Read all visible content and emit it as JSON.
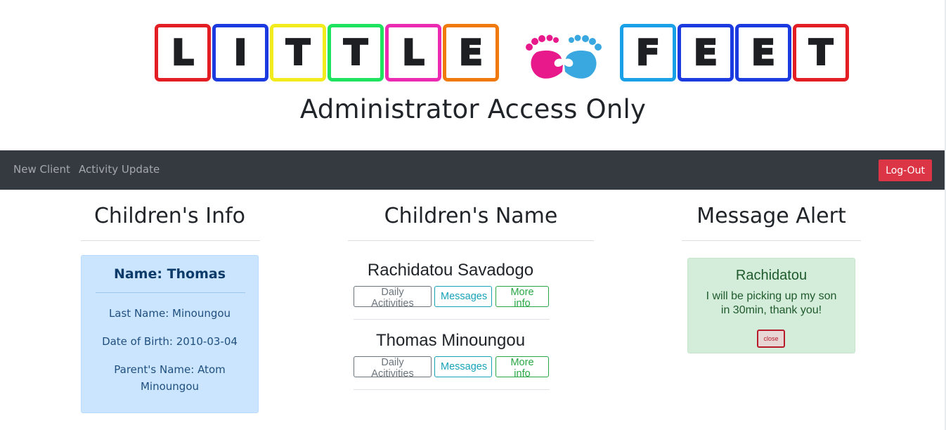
{
  "header": {
    "logo_letters_left": [
      "L",
      "I",
      "T",
      "T",
      "L",
      "E"
    ],
    "logo_letters_right": [
      "F",
      "E",
      "E",
      "T"
    ],
    "logo_colors_left": [
      "#e31e24",
      "#1b3be0",
      "#f2ec1f",
      "#1ee35e",
      "#ec2bb3",
      "#f07a0d"
    ],
    "logo_colors_right": [
      "#1aa0e6",
      "#1b3be0",
      "#1b3be0",
      "#e31e24"
    ],
    "feet_icon": "baby-footprints-icon",
    "feet_colors": [
      "#e8198b",
      "#3aa8e0"
    ],
    "title": "Administrator Access Only"
  },
  "navbar": {
    "links": [
      "New Client",
      "Activity Update"
    ],
    "logout_label": "Log-Out",
    "logout_color": "#dc3545",
    "background": "#343a40"
  },
  "info_column": {
    "heading": "Children's Info",
    "card": {
      "name": "Name: Thomas",
      "last_name": "Last Name: Minoungou",
      "dob": "Date of Birth: 2010-03-04",
      "parent_line1": "Parent's Name: Atom",
      "parent_line2": "Minoungou"
    }
  },
  "names_column": {
    "heading": "Children's Name",
    "children": [
      {
        "name": "Rachidatou Savadogo",
        "activities_label": "Daily Acitivities",
        "messages_label": "Messages",
        "more_label": "More info"
      },
      {
        "name": "Thomas Minoungou",
        "activities_label": "Daily Acitivities",
        "messages_label": "Messages",
        "more_label": "More info"
      }
    ]
  },
  "alert_column": {
    "heading": "Message Alert",
    "alert": {
      "sender": "Rachidatou",
      "message": "I will be picking up my son in 30min, thank you!",
      "close_label": "close"
    }
  }
}
